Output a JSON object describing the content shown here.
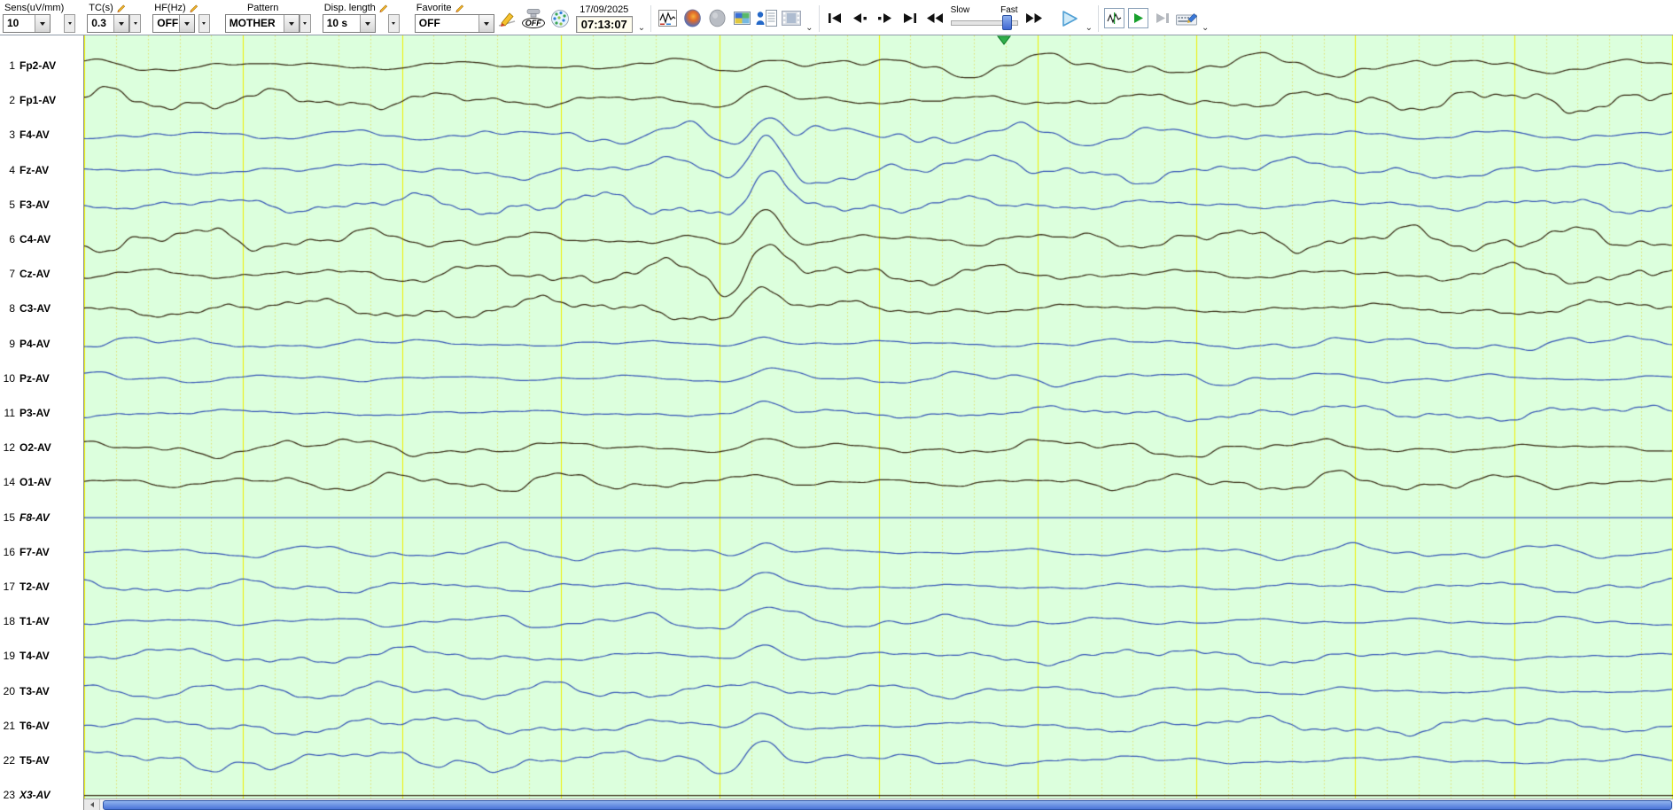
{
  "toolbar": {
    "sens": {
      "label": "Sens(uV/mm)",
      "value": "10"
    },
    "tc": {
      "label": "TC(s)",
      "value": "0.3"
    },
    "hf": {
      "label": "HF(Hz)",
      "value": "OFF"
    },
    "pattern": {
      "label": "Pattern",
      "value": "MOTHER"
    },
    "disp_length": {
      "label": "Disp. length",
      "value": "10 s"
    },
    "favorite": {
      "label": "Favorite",
      "value": "OFF"
    },
    "off_badge": "OFF",
    "date": "17/09/2025",
    "time": "07:13:07",
    "slider": {
      "slow": "Slow",
      "fast": "Fast"
    }
  },
  "icons": {
    "more": "⌄"
  },
  "channels": [
    {
      "num": "1",
      "label": "Fp2-AV",
      "color": "dark",
      "italic": false,
      "flat": false,
      "amp": 15,
      "ev": 1.0
    },
    {
      "num": "2",
      "label": "Fp1-AV",
      "color": "dark",
      "italic": false,
      "flat": false,
      "amp": 15,
      "ev": 1.1
    },
    {
      "num": "3",
      "label": "F4-AV",
      "color": "blue",
      "italic": false,
      "flat": false,
      "amp": 16,
      "ev": 2.1
    },
    {
      "num": "4",
      "label": "Fz-AV",
      "color": "blue",
      "italic": false,
      "flat": false,
      "amp": 16,
      "ev": 2.6
    },
    {
      "num": "5",
      "label": "F3-AV",
      "color": "blue",
      "italic": false,
      "flat": false,
      "amp": 15,
      "ev": 2.0
    },
    {
      "num": "6",
      "label": "C4-AV",
      "color": "dark",
      "italic": false,
      "flat": false,
      "amp": 16,
      "ev": 2.3
    },
    {
      "num": "7",
      "label": "Cz-AV",
      "color": "dark",
      "italic": false,
      "flat": false,
      "amp": 17,
      "ev": 2.5
    },
    {
      "num": "8",
      "label": "C3-AV",
      "color": "dark",
      "italic": false,
      "flat": false,
      "amp": 14,
      "ev": 1.7
    },
    {
      "num": "9",
      "label": "P4-AV",
      "color": "blue",
      "italic": false,
      "flat": false,
      "amp": 9,
      "ev": 1.1
    },
    {
      "num": "10",
      "label": "Pz-AV",
      "color": "blue",
      "italic": false,
      "flat": false,
      "amp": 9,
      "ev": 1.3
    },
    {
      "num": "11",
      "label": "P3-AV",
      "color": "blue",
      "italic": false,
      "flat": false,
      "amp": 10,
      "ev": 1.1
    },
    {
      "num": "12",
      "label": "O2-AV",
      "color": "dark",
      "italic": false,
      "flat": false,
      "amp": 12,
      "ev": 0.9
    },
    {
      "num": "14",
      "label": "O1-AV",
      "color": "dark",
      "italic": false,
      "flat": false,
      "amp": 13,
      "ev": 0.9
    },
    {
      "num": "15",
      "label": "F8-AV",
      "color": "blue",
      "italic": true,
      "flat": true,
      "amp": 0,
      "ev": 0
    },
    {
      "num": "16",
      "label": "F7-AV",
      "color": "blue",
      "italic": false,
      "flat": false,
      "amp": 10,
      "ev": 1.5
    },
    {
      "num": "17",
      "label": "T2-AV",
      "color": "blue",
      "italic": false,
      "flat": false,
      "amp": 10,
      "ev": 1.7
    },
    {
      "num": "18",
      "label": "T1-AV",
      "color": "blue",
      "italic": false,
      "flat": false,
      "amp": 10,
      "ev": 1.8
    },
    {
      "num": "19",
      "label": "T4-AV",
      "color": "blue",
      "italic": false,
      "flat": false,
      "amp": 11,
      "ev": 1.3
    },
    {
      "num": "20",
      "label": "T3-AV",
      "color": "blue",
      "italic": false,
      "flat": false,
      "amp": 11,
      "ev": 1.4
    },
    {
      "num": "21",
      "label": "T6-AV",
      "color": "blue",
      "italic": false,
      "flat": false,
      "amp": 12,
      "ev": 1.1
    },
    {
      "num": "22",
      "label": "T5-AV",
      "color": "blue",
      "italic": false,
      "flat": false,
      "amp": 13,
      "ev": 2.2
    },
    {
      "num": "23",
      "label": "X3-AV",
      "color": "dark",
      "italic": true,
      "flat": true,
      "amp": 0,
      "ev": 0
    }
  ],
  "trace": {
    "display_seconds": 10,
    "minor_per_second": 5,
    "marker_fraction": 0.579,
    "seed": 20250917
  },
  "colors": {
    "bg": "#dcffdd",
    "grid_major": "#efef00",
    "grid_minor": "#e0e06e",
    "trace_dark": "#33260f",
    "trace_blue": "#3454b5",
    "marker": "#2fae4a",
    "scroll_thumb": "#4a74d8"
  }
}
